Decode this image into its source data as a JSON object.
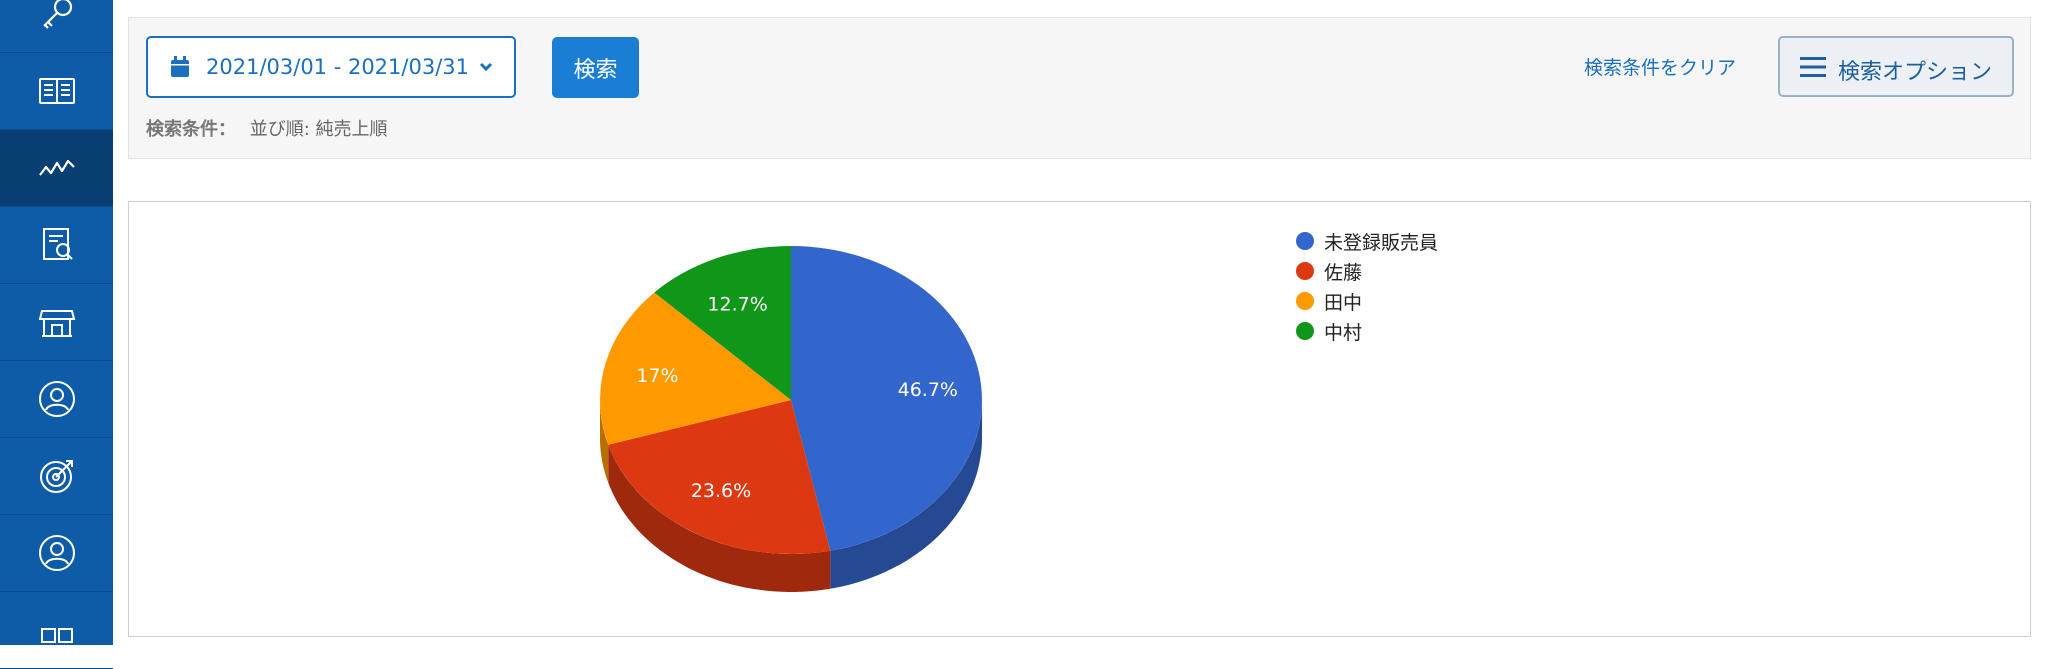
{
  "sidebar": {
    "items": [
      {
        "icon": "key-icon"
      },
      {
        "icon": "book-icon"
      },
      {
        "icon": "line-chart-icon",
        "active": true
      },
      {
        "icon": "report-icon"
      },
      {
        "icon": "store-icon"
      },
      {
        "icon": "user-circle-icon"
      },
      {
        "icon": "target-icon"
      },
      {
        "icon": "user-circle-icon"
      },
      {
        "icon": "grid-icon"
      }
    ]
  },
  "search": {
    "date_range": "2021/03/01 - 2021/03/31",
    "search_label": "検索",
    "conditions_label": "検索条件：",
    "conditions_value": "並び順: 純売上順",
    "clear_label": "検索条件をクリア",
    "options_label": "検索オプション"
  },
  "colors": {
    "sidebar": "#0e5ca8",
    "accent": "#1a7fd4"
  },
  "chart_data": {
    "type": "pie",
    "series": [
      {
        "name": "未登録販売員",
        "value": 46.7,
        "label": "46.7%",
        "color": "#3366cc"
      },
      {
        "name": "佐藤",
        "value": 23.6,
        "label": "23.6%",
        "color": "#dc3912"
      },
      {
        "name": "田中",
        "value": 17.0,
        "label": "17%",
        "color": "#ff9900"
      },
      {
        "name": "中村",
        "value": 12.7,
        "label": "12.7%",
        "color": "#109618"
      }
    ],
    "legend_position": "right",
    "style": "3d"
  }
}
